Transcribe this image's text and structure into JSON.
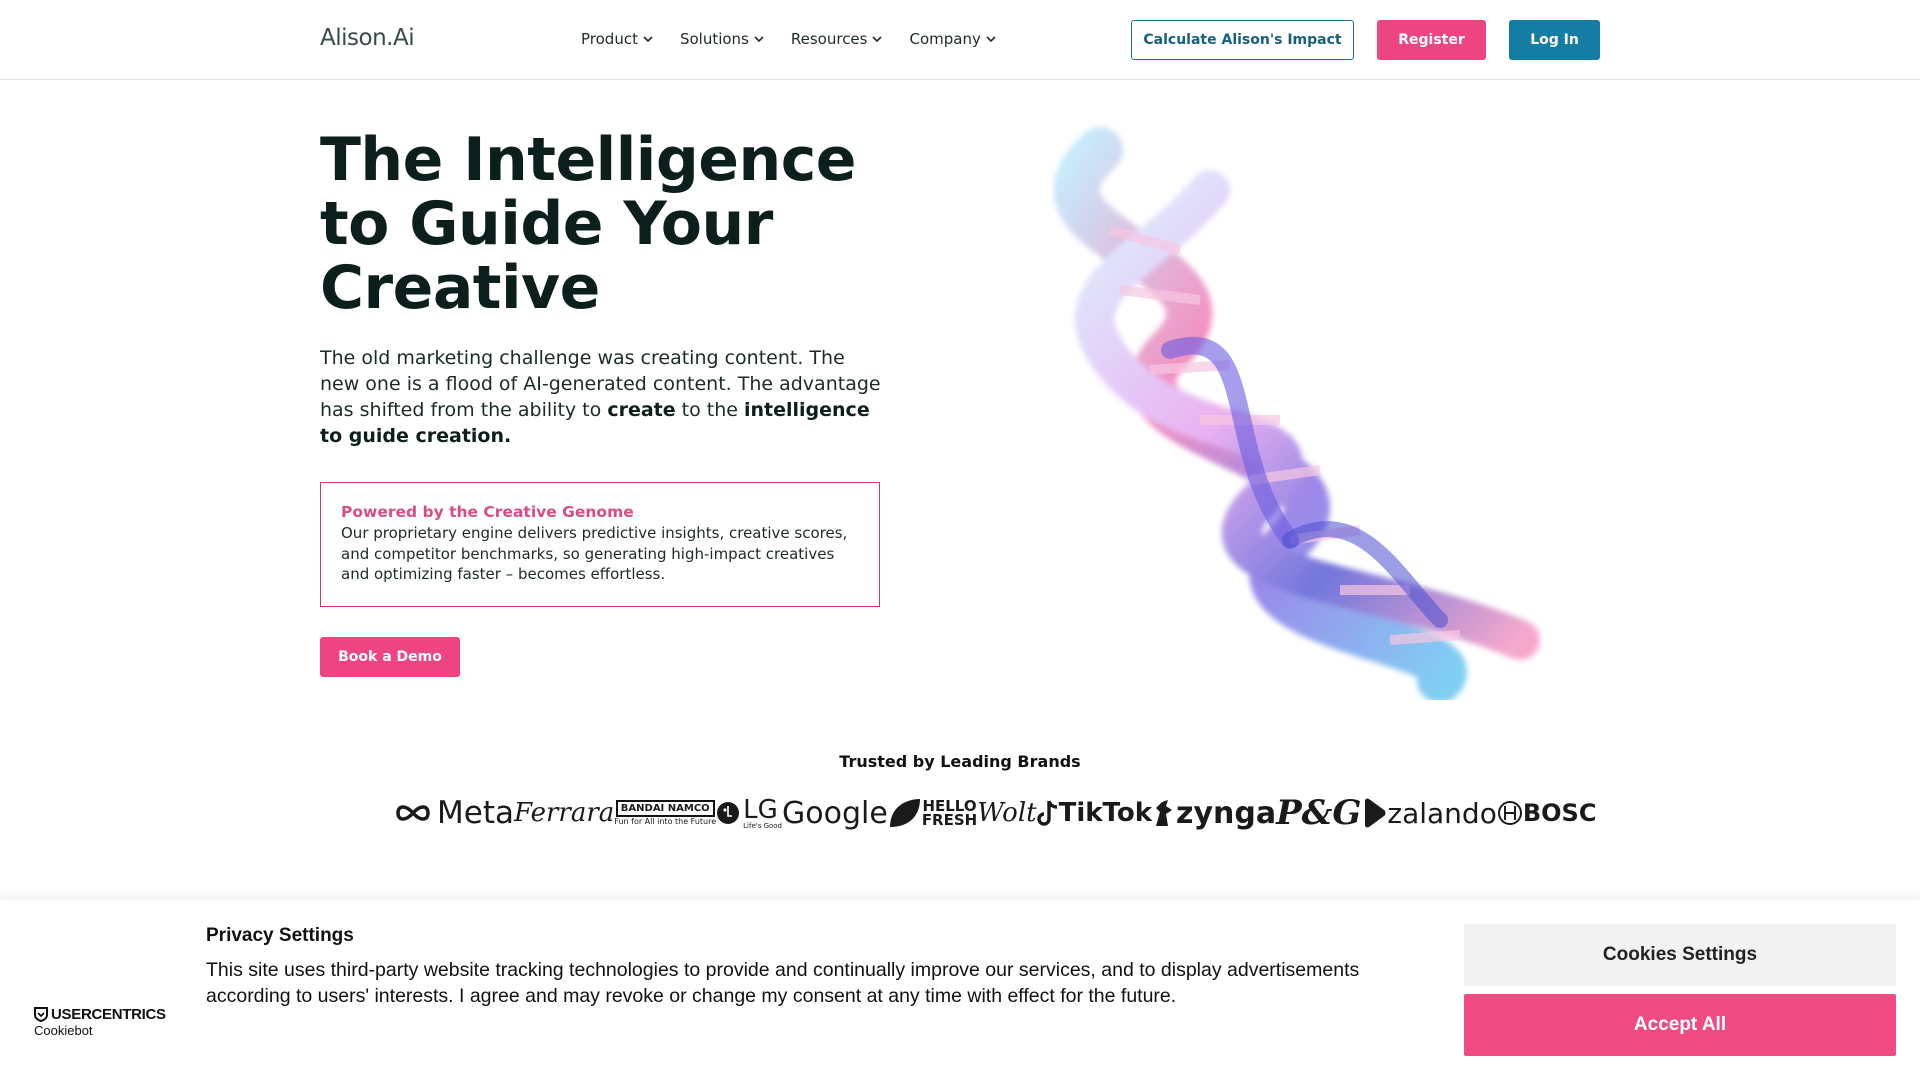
{
  "header": {
    "logo": "Alison.Ai",
    "nav": [
      {
        "label": "Product"
      },
      {
        "label": "Solutions"
      },
      {
        "label": "Resources"
      },
      {
        "label": "Company"
      }
    ],
    "impact_button": "Calculate Alison's Impact",
    "register_button": "Register",
    "login_button": "Log In"
  },
  "hero": {
    "title": "The Intelligence to Guide Your Creative",
    "desc_part1": "The old marketing challenge was creating content. The new one is a flood of AI-generated content. The advantage has shifted from the ability to ",
    "desc_bold1": "create",
    "desc_part2": " to the ",
    "desc_bold2": "intelligence to guide creation.",
    "genome_title": "Powered by the Creative Genome",
    "genome_text": "Our proprietary engine delivers predictive insights, creative scores, and competitor benchmarks, so generating high-impact creatives and optimizing faster – becomes effortless.",
    "demo_button": "Book a Demo"
  },
  "brands": {
    "heading": "Trusted by Leading Brands",
    "meta": "Meta",
    "ferrara": "Ferrara",
    "bandai": "BANDAI NAMCO",
    "bandai_tagline": "Fun for All into the Future",
    "lg": "LG",
    "lg_tagline": "Life's Good",
    "google": "Google",
    "hello": "HELLO",
    "fresh": "FRESH",
    "wolt": "Wolt",
    "tiktok": "TikTok",
    "zynga": "zynga",
    "pg": "P&G",
    "zalando": "zalando",
    "bosch": "BOSC"
  },
  "cookie": {
    "brand": "USERCENTRICS",
    "brand_sub": "Cookiebot",
    "title": "Privacy Settings",
    "text": "This site uses third-party website tracking technologies to provide and continually improve our services, and to display advertisements according to users' interests. I agree and may revoke or change my consent at any time with effect for the future.",
    "settings_button": "Cookies Settings",
    "accept_button": "Accept All"
  },
  "colors": {
    "accent_pink": "#ed4581",
    "accent_blue": "#157da4",
    "outline_blue": "#1a6a8a"
  }
}
